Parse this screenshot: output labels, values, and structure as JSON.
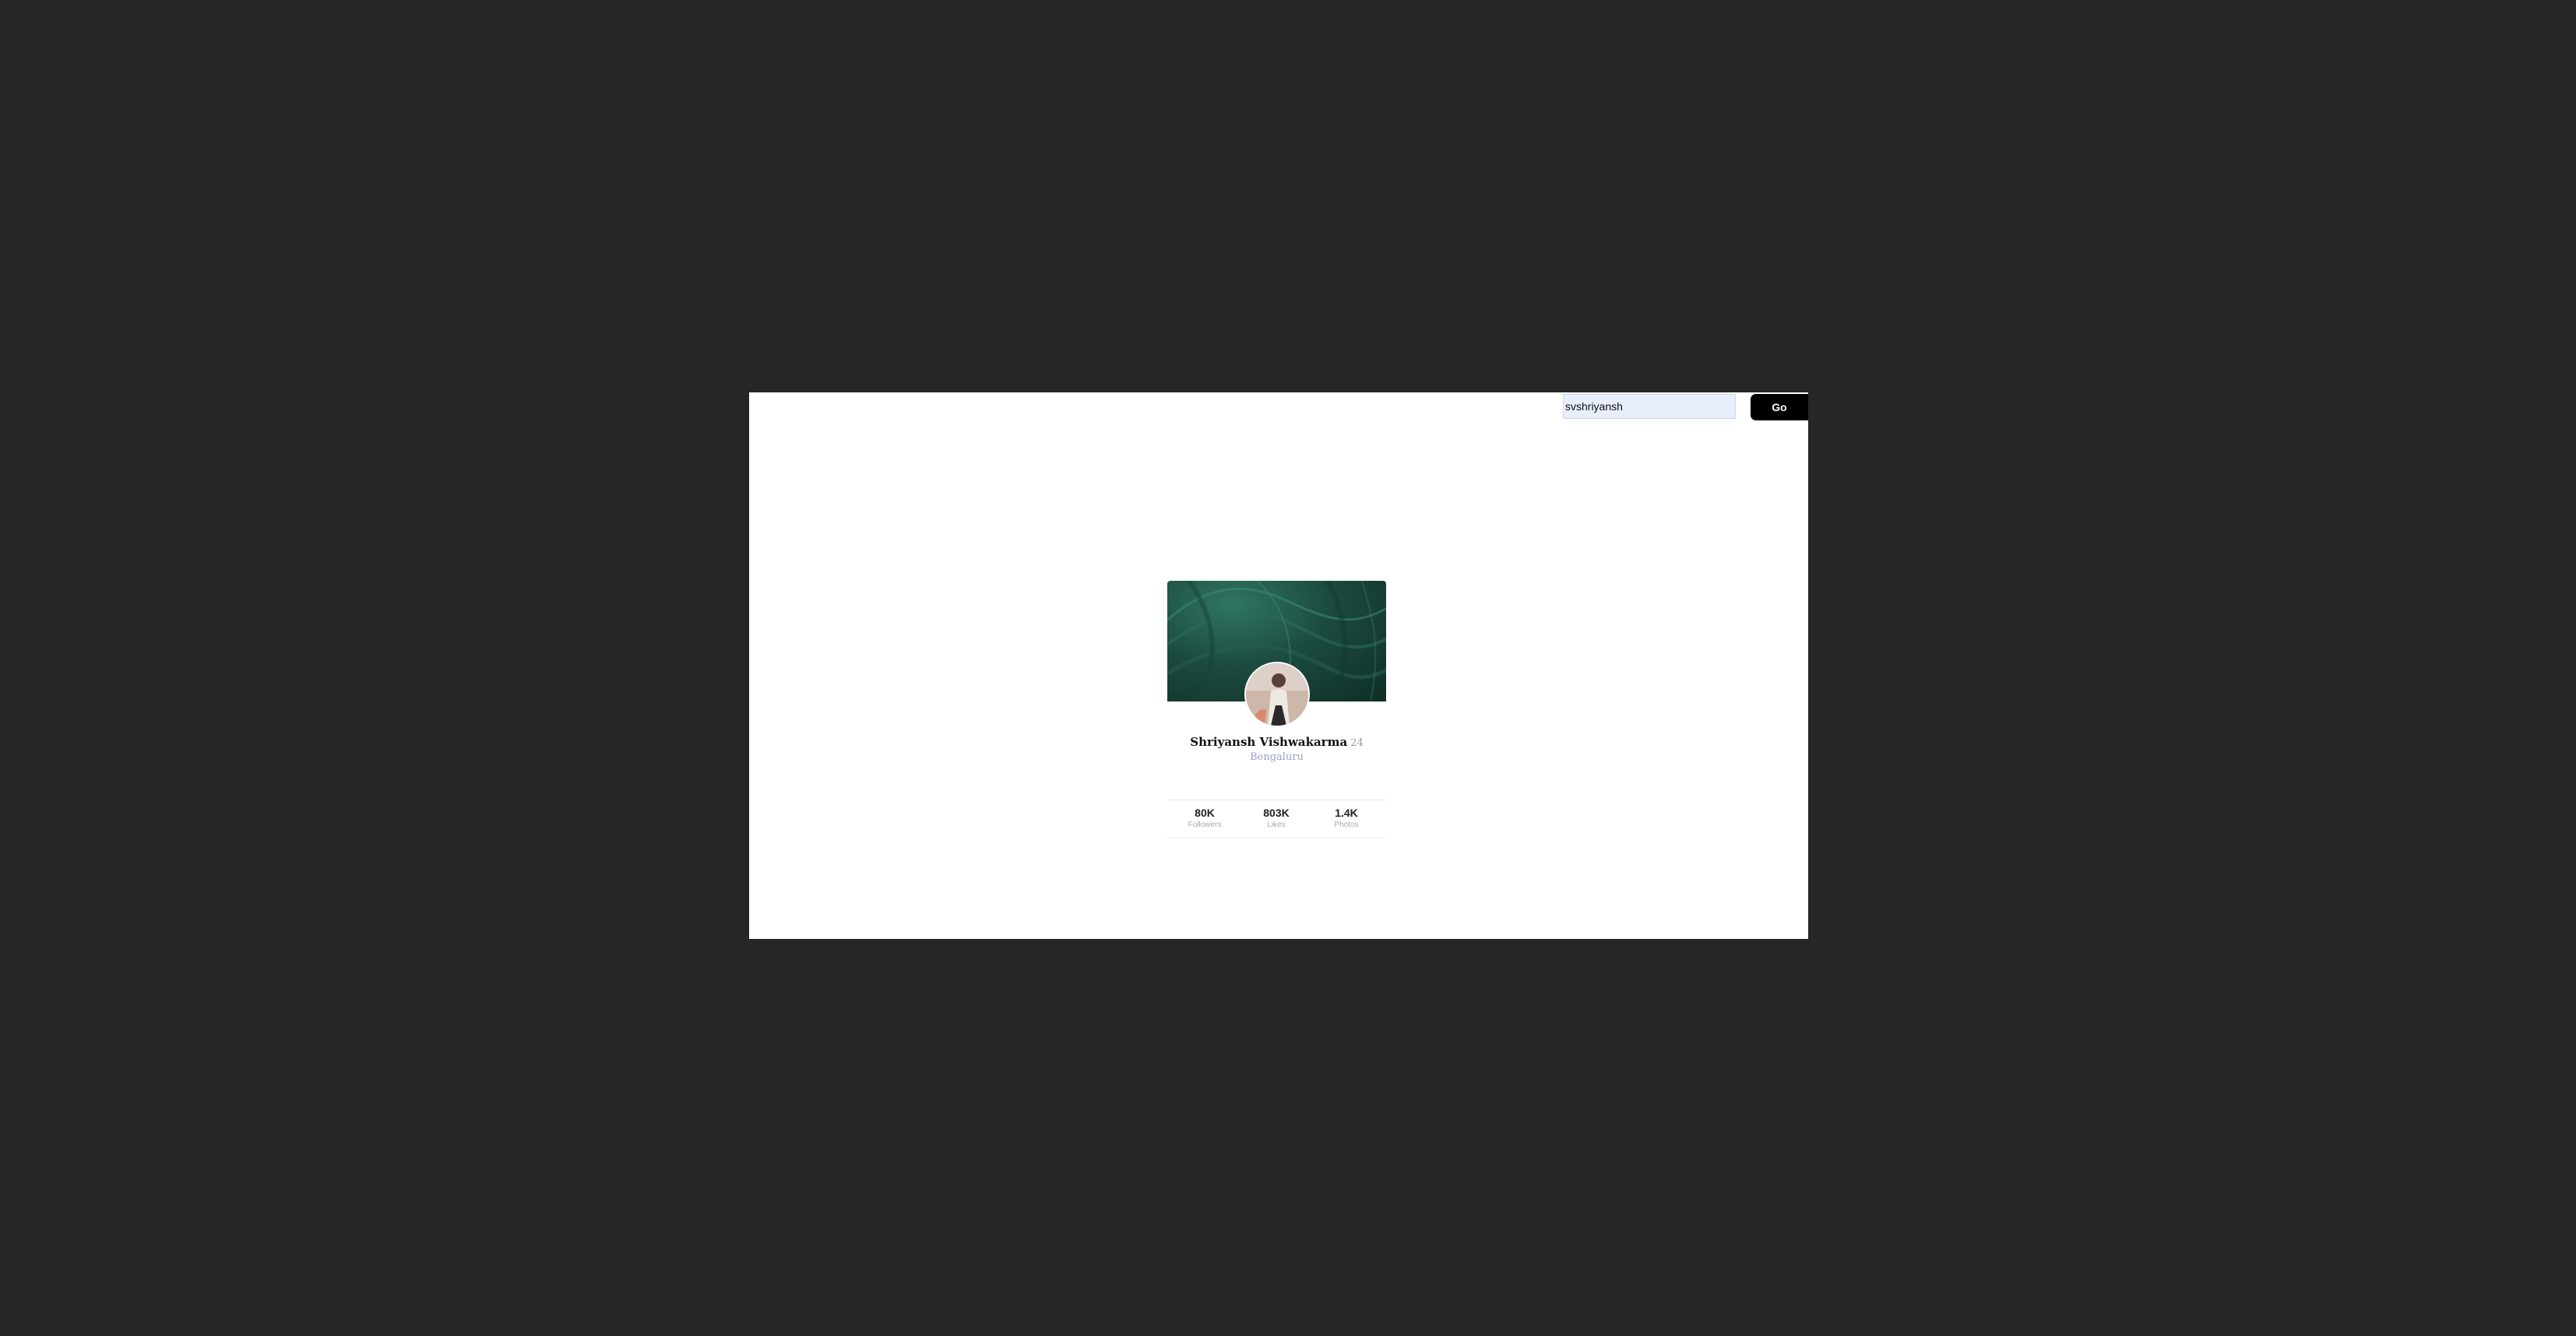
{
  "search": {
    "value": "svshriyansh"
  },
  "go_button": {
    "label": "Go"
  },
  "profile": {
    "name": "Shriyansh Vishwakarma",
    "age": "24",
    "location": "Bengaluru",
    "cover_color": "#1b4b3f",
    "stats": [
      {
        "value": "80K",
        "label": "Followers"
      },
      {
        "value": "803K",
        "label": "Likes"
      },
      {
        "value": "1.4K",
        "label": "Photos"
      }
    ]
  }
}
